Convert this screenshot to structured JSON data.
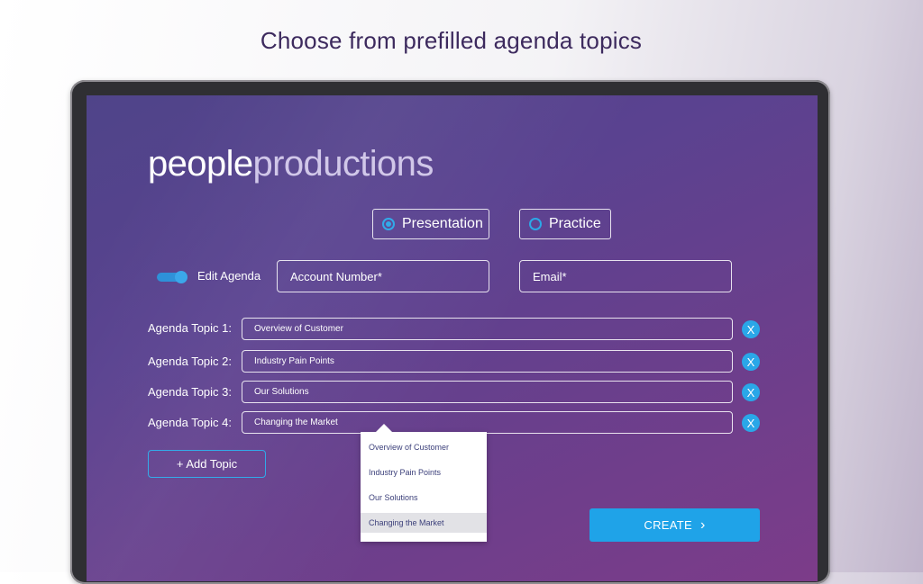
{
  "headline": "Choose from prefilled agenda topics",
  "logo": {
    "part1": "people",
    "part2": "productions"
  },
  "mode": {
    "options": [
      {
        "label": "Presentation",
        "selected": true
      },
      {
        "label": "Practice",
        "selected": false
      }
    ]
  },
  "edit_agenda": {
    "label": "Edit Agenda",
    "enabled": true
  },
  "fields": {
    "account": "Account Number*",
    "email": "Email*"
  },
  "topics": [
    {
      "label": "Agenda Topic 1:",
      "value": "Overview of Customer"
    },
    {
      "label": "Agenda Topic 2:",
      "value": "Industry Pain Points"
    },
    {
      "label": "Agenda Topic 3:",
      "value": "Our Solutions"
    },
    {
      "label": "Agenda Topic 4:",
      "value": "Changing the Market"
    }
  ],
  "remove_label": "X",
  "add_topic_label": "+ Add Topic",
  "dropdown": {
    "options": [
      "Overview of Customer",
      "Industry Pain Points",
      "Our Solutions",
      "Changing the Market"
    ],
    "selected": "Changing the Market"
  },
  "create_label": "CREATE",
  "colors": {
    "accent": "#1fa3e8",
    "headline": "#3d2a5e"
  }
}
